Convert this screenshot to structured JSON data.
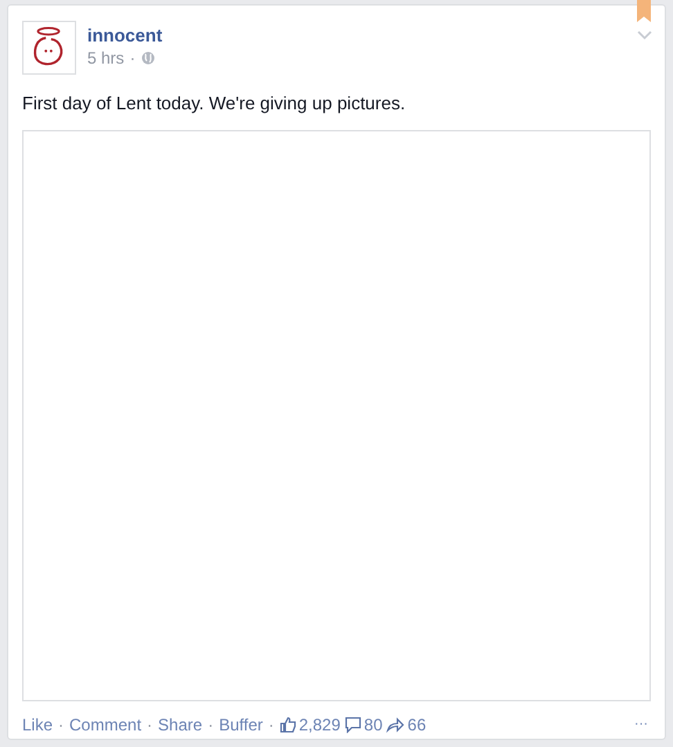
{
  "post": {
    "author": "innocent",
    "time": "5 hrs",
    "separator": "·",
    "text": "First day of Lent today. We're giving up pictures."
  },
  "actions": [
    "Like",
    "Comment",
    "Share",
    "Buffer"
  ],
  "stats": {
    "likes": "2,829",
    "comments": "80",
    "shares": "66"
  },
  "more": "···"
}
